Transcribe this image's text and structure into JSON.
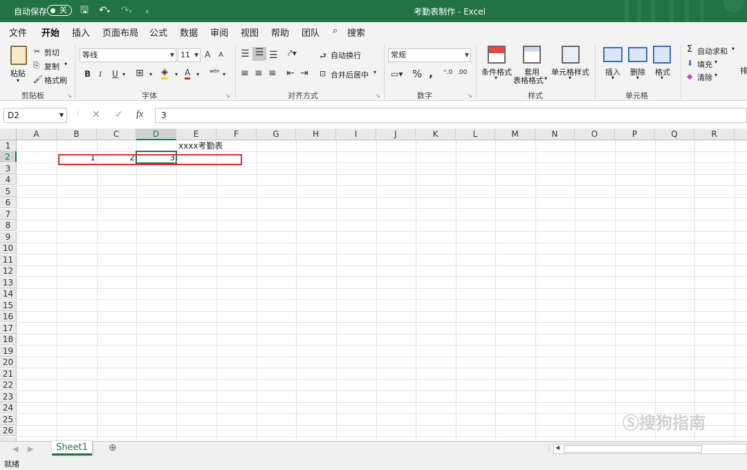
{
  "title_bar": {
    "autosave_label": "自动保存",
    "autosave_state": "关",
    "window_title": "考勤表制作 - Excel"
  },
  "ribbon_tabs": [
    "文件",
    "开始",
    "插入",
    "页面布局",
    "公式",
    "数据",
    "审阅",
    "视图",
    "帮助",
    "团队",
    "搜索"
  ],
  "active_tab": "开始",
  "clipboard": {
    "paste": "粘贴",
    "cut": "剪切",
    "copy": "复制",
    "format_painter": "格式刷",
    "group": "剪贴板"
  },
  "font": {
    "name": "等线",
    "size": "11",
    "bold": "B",
    "italic": "I",
    "underline": "U",
    "grow": "A",
    "shrink": "A",
    "font_color": "A",
    "phonetic": "wén",
    "group": "字体"
  },
  "alignment": {
    "wrap": "自动换行",
    "merge": "合并后居中",
    "group": "对齐方式"
  },
  "number": {
    "format": "常规",
    "percent": "%",
    "comma": ",",
    "group": "数字"
  },
  "styles": {
    "conditional": "条件格式",
    "table1": "套用",
    "table2": "表格格式",
    "cell_styles": "单元格样式",
    "group": "样式"
  },
  "cells": {
    "insert": "插入",
    "delete": "删除",
    "format": "格式",
    "group": "单元格"
  },
  "editing": {
    "autosum": "自动求和",
    "fill": "填充",
    "clear": "清除",
    "sort": "排"
  },
  "formula_bar": {
    "name_box": "D2",
    "fx": "fx",
    "content": "3"
  },
  "columns": [
    "A",
    "B",
    "C",
    "D",
    "E",
    "F",
    "G",
    "H",
    "I",
    "J",
    "K",
    "L",
    "M",
    "N",
    "O",
    "P",
    "Q",
    "R"
  ],
  "rows": [
    "1",
    "2",
    "3",
    "4",
    "5",
    "6",
    "7",
    "8",
    "9",
    "10",
    "11",
    "12",
    "13",
    "14",
    "15",
    "16",
    "17",
    "18",
    "19",
    "20",
    "21",
    "22",
    "23",
    "24",
    "25",
    "26"
  ],
  "cells_data": {
    "E1": "xxxx考勤表",
    "B2": "1",
    "C2": "2",
    "D2": "3"
  },
  "selected_cell": "D2",
  "sheets": [
    "Sheet1"
  ],
  "status": "就绪",
  "watermark": "搜狗指南",
  "colors": {
    "excel_green": "#217346",
    "highlight_red": "#e02b2b"
  }
}
